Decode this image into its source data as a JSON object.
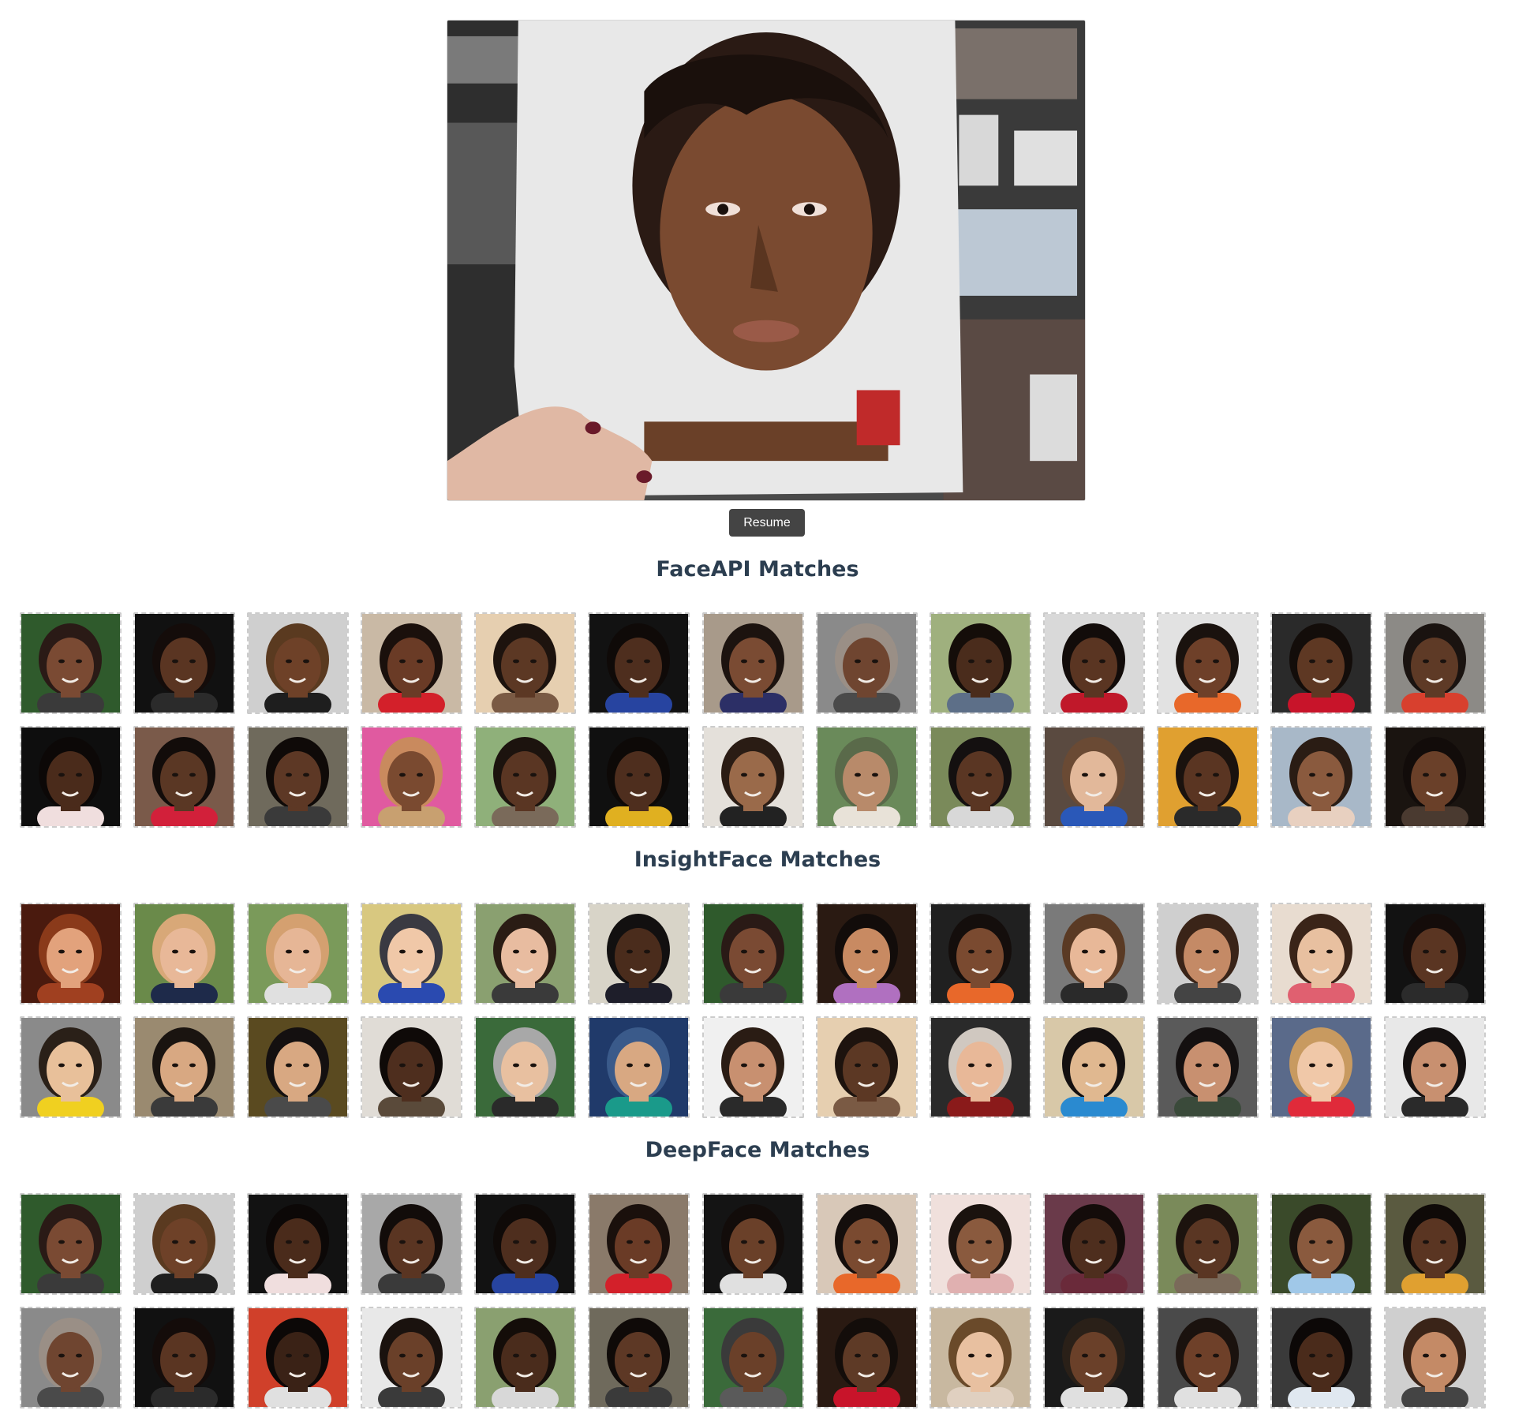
{
  "camera": {
    "resume_label": "Resume"
  },
  "sections": [
    {
      "id": "faceapi",
      "title": "FaceAPI Matches",
      "matches": [
        {
          "bg": "#2f5a2c",
          "skin": "#7a4a33",
          "hair": "#2a1a16",
          "shirt": "#3a3a3a"
        },
        {
          "bg": "#111111",
          "skin": "#5a3522",
          "hair": "#140c0a",
          "shirt": "#2b2b2b"
        },
        {
          "bg": "#cfcfcf",
          "skin": "#6e4128",
          "hair": "#5a3a20",
          "shirt": "#1e1e1e"
        },
        {
          "bg": "#c9b9a5",
          "skin": "#6a3b26",
          "hair": "#1a100c",
          "shirt": "#d3202a"
        },
        {
          "bg": "#e6cfb0",
          "skin": "#5c3824",
          "hair": "#1d130e",
          "shirt": "#7a5a44"
        },
        {
          "bg": "#121212",
          "skin": "#4e2e1e",
          "hair": "#0f0a08",
          "shirt": "#2744a0"
        },
        {
          "bg": "#a89a8a",
          "skin": "#7a4b33",
          "hair": "#1c130f",
          "shirt": "#2c2f66"
        },
        {
          "bg": "#8a8a8a",
          "skin": "#6f4530",
          "hair": "#9a8f86",
          "shirt": "#4a4a4a"
        },
        {
          "bg": "#9fb07e",
          "skin": "#4a2c1c",
          "hair": "#140d09",
          "shirt": "#5d6f88"
        },
        {
          "bg": "#d9d9d9",
          "skin": "#5a3522",
          "hair": "#120c0a",
          "shirt": "#c0182a"
        },
        {
          "bg": "#e2e2e2",
          "skin": "#6e4029",
          "hair": "#1a120e",
          "shirt": "#e8682a"
        },
        {
          "bg": "#2a2a2a",
          "skin": "#5e3823",
          "hair": "#130d0a",
          "shirt": "#c8142a"
        },
        {
          "bg": "#8c8a86",
          "skin": "#5e3a26",
          "hair": "#1a1310",
          "shirt": "#d8402e"
        },
        {
          "bg": "#0e0e0e",
          "skin": "#4a2b1b",
          "hair": "#0c0807",
          "shirt": "#f0dede"
        },
        {
          "bg": "#7a5a4a",
          "skin": "#5a3724",
          "hair": "#120c0a",
          "shirt": "#d2203a"
        },
        {
          "bg": "#6f6a5c",
          "skin": "#5d3825",
          "hair": "#0f0a08",
          "shirt": "#3a3a3a"
        },
        {
          "bg": "#e05aa0",
          "skin": "#7a4a30",
          "hair": "#c98a5e",
          "shirt": "#c8a070"
        },
        {
          "bg": "#8fb07a",
          "skin": "#5a3623",
          "hair": "#1c130e",
          "shirt": "#7a6a5a"
        },
        {
          "bg": "#101010",
          "skin": "#4e2e1e",
          "hair": "#0d0907",
          "shirt": "#e0b020"
        },
        {
          "bg": "#e4e0da",
          "skin": "#9a6a4a",
          "hair": "#2a1c14",
          "shirt": "#222222"
        },
        {
          "bg": "#6a8a5a",
          "skin": "#b88a6a",
          "hair": "#5a6a4a",
          "shirt": "#e8e2d8"
        },
        {
          "bg": "#7a8a5a",
          "skin": "#5a3623",
          "hair": "#141010",
          "shirt": "#d8d8d8"
        },
        {
          "bg": "#5a4a40",
          "skin": "#e2b89a",
          "hair": "#6a4a34",
          "shirt": "#2a58b8"
        },
        {
          "bg": "#e0a030",
          "skin": "#5a3522",
          "hair": "#1a120e",
          "shirt": "#2a2a2a"
        },
        {
          "bg": "#a8b8c8",
          "skin": "#8a5a3e",
          "hair": "#2a1c14",
          "shirt": "#e8d0c0"
        },
        {
          "bg": "#1a1410",
          "skin": "#6a4029",
          "hair": "#120c0a",
          "shirt": "#4a3a30"
        }
      ]
    },
    {
      "id": "insightface",
      "title": "InsightFace Matches",
      "matches": [
        {
          "bg": "#4a1a0e",
          "skin": "#e2a27c",
          "hair": "#8a3a1a",
          "shirt": "#a04020"
        },
        {
          "bg": "#6a8a4a",
          "skin": "#e8b898",
          "hair": "#d8a878",
          "shirt": "#1e2a4a"
        },
        {
          "bg": "#7a9a5a",
          "skin": "#e6b696",
          "hair": "#d4a070",
          "shirt": "#e0e0e0"
        },
        {
          "bg": "#d8c880",
          "skin": "#f0c8a8",
          "hair": "#3a3a42",
          "shirt": "#2a4ab0"
        },
        {
          "bg": "#8aa070",
          "skin": "#e8bca0",
          "hair": "#2a1c14",
          "shirt": "#3a3a3a"
        },
        {
          "bg": "#d8d4c8",
          "skin": "#4a2c1c",
          "hair": "#121010",
          "shirt": "#1e1e2a"
        },
        {
          "bg": "#2f5a2c",
          "skin": "#7a4a33",
          "hair": "#2a1a16",
          "shirt": "#3a3a3a"
        },
        {
          "bg": "#2a1a12",
          "skin": "#c88a62",
          "hair": "#120c0a",
          "shirt": "#b070c0"
        },
        {
          "bg": "#202020",
          "skin": "#7a4a30",
          "hair": "#140e0c",
          "shirt": "#e8682a"
        },
        {
          "bg": "#7a7a7a",
          "skin": "#e8b898",
          "hair": "#5a3a24",
          "shirt": "#2a2a2a"
        },
        {
          "bg": "#cfcfcf",
          "skin": "#c48a66",
          "hair": "#3a2418",
          "shirt": "#444444"
        },
        {
          "bg": "#e8dcd0",
          "skin": "#e8c0a0",
          "hair": "#3a2418",
          "shirt": "#e06070"
        },
        {
          "bg": "#121212",
          "skin": "#5a3522",
          "hair": "#140c0a",
          "shirt": "#2b2b2b"
        },
        {
          "bg": "#8a8a8a",
          "skin": "#e8c09a",
          "hair": "#2a2018",
          "shirt": "#f0d020"
        },
        {
          "bg": "#9a8a70",
          "skin": "#d8a882",
          "hair": "#1a1410",
          "shirt": "#3a3a3a"
        },
        {
          "bg": "#5a4a20",
          "skin": "#d8a882",
          "hair": "#141010",
          "shirt": "#4a4a4a"
        },
        {
          "bg": "#e0dcd6",
          "skin": "#4e2e1e",
          "hair": "#0f0a08",
          "shirt": "#5a4a3a"
        },
        {
          "bg": "#3a6a3a",
          "skin": "#e8c0a0",
          "hair": "#a8a8a8",
          "shirt": "#2a2a2a"
        },
        {
          "bg": "#203a6a",
          "skin": "#d8a882",
          "hair": "#3a5a8a",
          "shirt": "#1a9a8a"
        },
        {
          "bg": "#f0f0f0",
          "skin": "#c89070",
          "hair": "#2a1c14",
          "shirt": "#2a2a2a"
        },
        {
          "bg": "#e6cfb0",
          "skin": "#5c3824",
          "hair": "#1d130e",
          "shirt": "#7a5a44"
        },
        {
          "bg": "#2a2a2a",
          "skin": "#e8b898",
          "hair": "#d0c8c0",
          "shirt": "#8a1a1a"
        },
        {
          "bg": "#d8c8a8",
          "skin": "#e0b890",
          "hair": "#141010",
          "shirt": "#2a8ad0"
        },
        {
          "bg": "#5a5a5a",
          "skin": "#c89070",
          "hair": "#141010",
          "shirt": "#3a4a3a"
        },
        {
          "bg": "#5a6a8a",
          "skin": "#f0c8a8",
          "hair": "#c89a60",
          "shirt": "#e02a3a"
        },
        {
          "bg": "#e8e8e8",
          "skin": "#c89070",
          "hair": "#141010",
          "shirt": "#2a2a2a"
        }
      ]
    },
    {
      "id": "deepface",
      "title": "DeepFace Matches",
      "matches": [
        {
          "bg": "#2f5a2c",
          "skin": "#7a4a33",
          "hair": "#2a1a16",
          "shirt": "#3a3a3a"
        },
        {
          "bg": "#cfcfcf",
          "skin": "#6e4128",
          "hair": "#5a3a20",
          "shirt": "#1e1e1e"
        },
        {
          "bg": "#121212",
          "skin": "#4a2b1b",
          "hair": "#0c0807",
          "shirt": "#f0dede"
        },
        {
          "bg": "#a8a8a8",
          "skin": "#5a3522",
          "hair": "#120c0a",
          "shirt": "#3a3a3a"
        },
        {
          "bg": "#121212",
          "skin": "#4e2e1e",
          "hair": "#0f0a08",
          "shirt": "#2744a0"
        },
        {
          "bg": "#8a7a6a",
          "skin": "#6a3b26",
          "hair": "#1a100c",
          "shirt": "#d3202a"
        },
        {
          "bg": "#141414",
          "skin": "#6a4029",
          "hair": "#120c0a",
          "shirt": "#e0e0e0"
        },
        {
          "bg": "#d8c8b8",
          "skin": "#7a4a30",
          "hair": "#140e0c",
          "shirt": "#e8682a"
        },
        {
          "bg": "#f0e0dc",
          "skin": "#8a5a3e",
          "hair": "#1a120e",
          "shirt": "#e0b0b0"
        },
        {
          "bg": "#6a3a4a",
          "skin": "#4e2e1e",
          "hair": "#140c0a",
          "shirt": "#6a2a3a"
        },
        {
          "bg": "#7a8a5a",
          "skin": "#5a3623",
          "hair": "#1c130e",
          "shirt": "#7a6a5a"
        },
        {
          "bg": "#3a4a2a",
          "skin": "#8a5a3e",
          "hair": "#1a120e",
          "shirt": "#a0c8e8"
        },
        {
          "bg": "#5a5a40",
          "skin": "#5a3522",
          "hair": "#0f0a08",
          "shirt": "#e0a030"
        },
        {
          "bg": "#8a8a8a",
          "skin": "#6f4530",
          "hair": "#9a8f86",
          "shirt": "#4a4a4a"
        },
        {
          "bg": "#111111",
          "skin": "#5a3522",
          "hair": "#140c0a",
          "shirt": "#2b2b2b"
        },
        {
          "bg": "#d0402a",
          "skin": "#3a2216",
          "hair": "#0c0807",
          "shirt": "#e0e0e0"
        },
        {
          "bg": "#e8e8e8",
          "skin": "#6a4029",
          "hair": "#1a120e",
          "shirt": "#3a3a3a"
        },
        {
          "bg": "#8aa070",
          "skin": "#4a2c1c",
          "hair": "#140d09",
          "shirt": "#d8d8d8"
        },
        {
          "bg": "#6f6a5c",
          "skin": "#5d3825",
          "hair": "#0f0a08",
          "shirt": "#3a3a3a"
        },
        {
          "bg": "#3a6a3a",
          "skin": "#6a4029",
          "hair": "#3a3a3a",
          "shirt": "#5a5a5a"
        },
        {
          "bg": "#2a1a12",
          "skin": "#5e3a26",
          "hair": "#130d0a",
          "shirt": "#c8142a"
        },
        {
          "bg": "#c8b8a0",
          "skin": "#e8c0a0",
          "hair": "#6a4a2a",
          "shirt": "#e0d0c0"
        },
        {
          "bg": "#1a1a1a",
          "skin": "#6a4029",
          "hair": "#2a2018",
          "shirt": "#e0e0e0"
        },
        {
          "bg": "#4a4a4a",
          "skin": "#6e4029",
          "hair": "#1a120e",
          "shirt": "#e0e0e0"
        },
        {
          "bg": "#3a3a3a",
          "skin": "#4a2b1b",
          "hair": "#0c0807",
          "shirt": "#e0e8f0"
        },
        {
          "bg": "#cfcfcf",
          "skin": "#c48a66",
          "hair": "#3a2418",
          "shirt": "#444444"
        }
      ]
    }
  ]
}
